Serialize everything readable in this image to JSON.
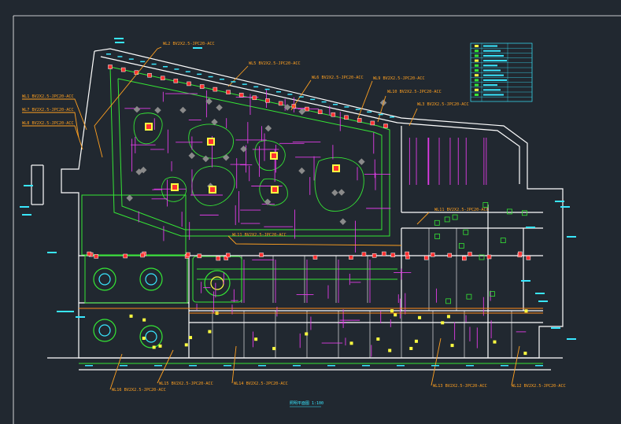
{
  "drawing": {
    "title": "照明平面图 1:100",
    "colors": {
      "background": "#212830",
      "frame": "#ffffff",
      "walls": "#ffffff",
      "green": "#35e635",
      "magenta": "#e03ce6",
      "orange": "#ffa020",
      "cyan": "#39e7ff",
      "red": "#ff3030",
      "yellow": "#ffff40"
    }
  },
  "circuit_labels": [
    "WL2 BV2X2.5-JPC20-ACC",
    "WL5 BV2X2.5-JPC20-ACC",
    "WL1 BV2X2.5-JPC20-ACC",
    "WL7 BV2X2.5-JPC20-ACC",
    "WL8 BV2X2.5-JPC20-ACC",
    "WL6 BV2X2.5-JPC20-ACC",
    "WL9 BV2X2.5-JPC20-ACC",
    "WL10 BV2X2.5-JPC20-ACC",
    "WL3 BV2X2.5-JPC20-ACC",
    "WL11 BV2X2.5-JPC20-ACC",
    "WL11 BV2X2.5-JPC20-ACC",
    "WL16 BV2X2.5-JPC20-ACC",
    "WL15 BV2X2.5-JPC20-ACC",
    "WL14 BV2X2.5-JPC20-ACC",
    "WL13 BV2X2.5-JPC20-ACC",
    "WL12 BV2X2.5-JPC20-ACC"
  ],
  "legend_icon": "legend-table-icon"
}
